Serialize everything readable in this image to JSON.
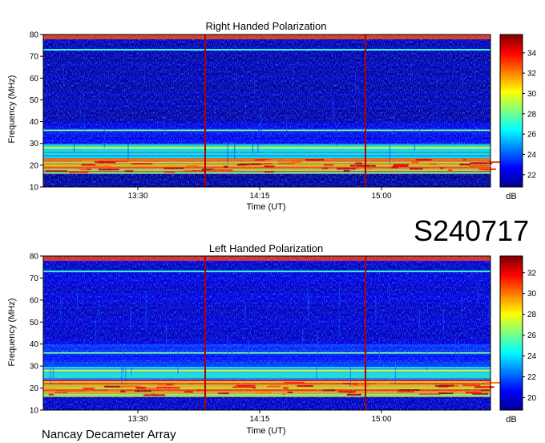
{
  "figure": {
    "observation_id": "S240717",
    "footer": "Nancay Decameter Array"
  },
  "chart_data": [
    {
      "type": "heatmap",
      "title": "Right Handed Polarization",
      "xlabel": "Time (UT)",
      "ylabel": "Frequency (MHz)",
      "colorbar_label": "dB",
      "x_ticks": [
        "13:30",
        "14:15",
        "15:00"
      ],
      "y_ticks": [
        "10",
        "20",
        "30",
        "40",
        "50",
        "60",
        "70",
        "80"
      ],
      "colorbar_ticks": [
        "22",
        "24",
        "26",
        "28",
        "30",
        "32",
        "34"
      ],
      "ylim": [
        10,
        80
      ],
      "colorbar_range": [
        20.8,
        35.8
      ],
      "background_level_db": 21.5,
      "intense_band_db": 33,
      "colormap": "jet",
      "colors": {
        "low": "#00008f",
        "mid": "#7fff7f",
        "high": "#7f0000",
        "marker_line": "#b00000"
      }
    },
    {
      "type": "heatmap",
      "title": "Left Handed Polarization",
      "xlabel": "Time (UT)",
      "ylabel": "Frequency (MHz)",
      "colorbar_label": "dB",
      "x_ticks": [
        "13:30",
        "14:15",
        "15:00"
      ],
      "y_ticks": [
        "10",
        "20",
        "30",
        "40",
        "50",
        "60",
        "70",
        "80"
      ],
      "colorbar_ticks": [
        "20",
        "22",
        "24",
        "26",
        "28",
        "30",
        "32"
      ],
      "ylim": [
        10,
        80
      ],
      "colorbar_range": [
        18.8,
        33.6
      ],
      "background_level_db": 20.0,
      "intense_band_db": 31,
      "colormap": "jet",
      "colors": {
        "low": "#00008f",
        "mid": "#7fff7f",
        "high": "#7f0000",
        "marker_line": "#b00000"
      }
    }
  ]
}
